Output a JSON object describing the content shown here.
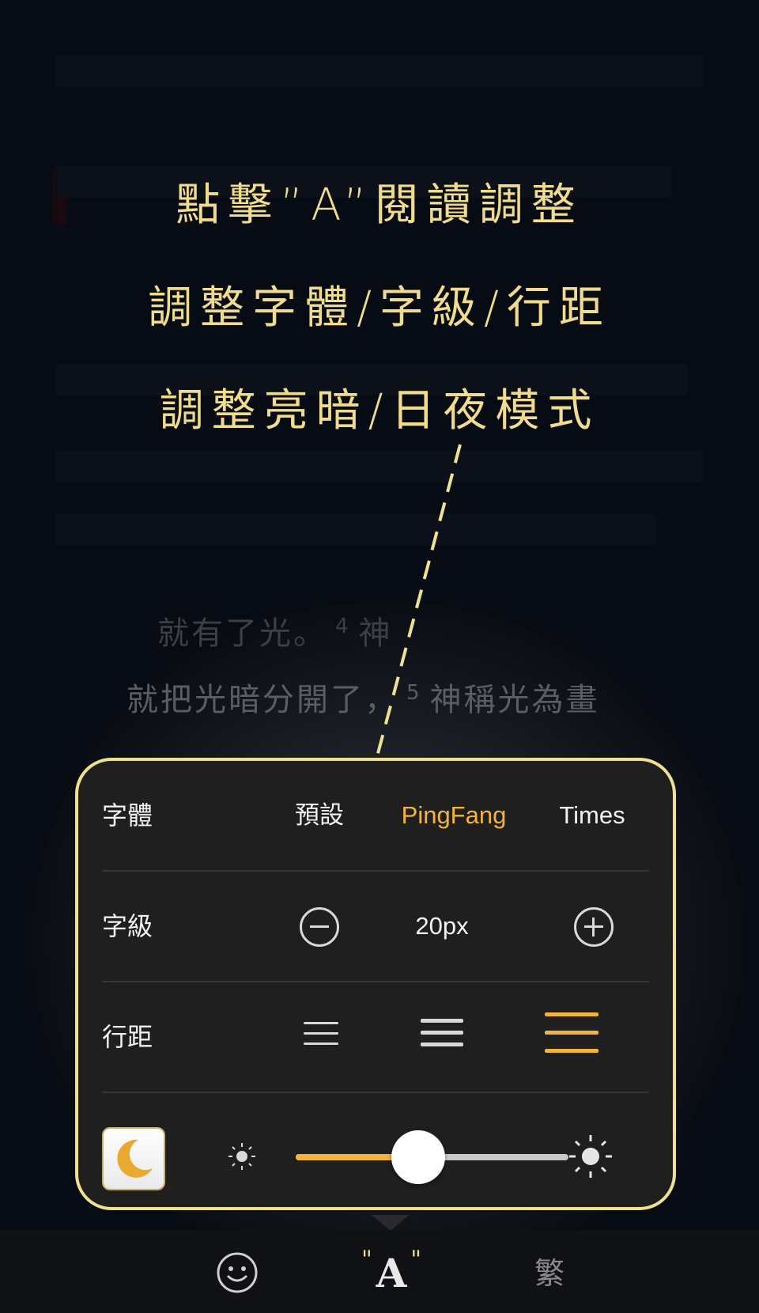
{
  "tutorial": {
    "caption_1": "點擊”A”閱讀調整",
    "caption_2": "調整字體/字級/行距",
    "caption_3": "調整亮暗/日夜模式"
  },
  "background_text": {
    "line_1_a": "就有了光。",
    "line_1_sup": "4",
    "line_1_b": "神",
    "line_2_a": "就把光暗分開了，",
    "line_2_sup": "5",
    "line_2_b": "神稱光為畫"
  },
  "settings": {
    "font": {
      "label": "字體",
      "options": [
        "預設",
        "PingFang",
        "Times"
      ],
      "selected": "PingFang"
    },
    "size": {
      "label": "字級",
      "value": "20px"
    },
    "spacing": {
      "label": "行距",
      "selected": "wide"
    },
    "brightness": {
      "level": 0.45,
      "night_mode_icon": "moon-icon"
    }
  },
  "toolbar": {
    "reading_settings_label": "A",
    "traditional_label": "繁"
  },
  "colors": {
    "accent": "#f3b43c",
    "caption": "#f0dc8c",
    "panel_border": "#efe28e",
    "panel_bg": "#1f1f20"
  }
}
